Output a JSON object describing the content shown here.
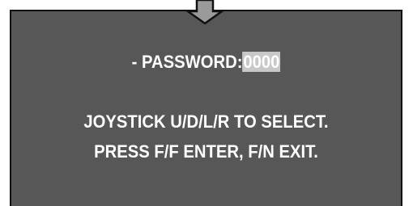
{
  "password": {
    "label": "- PASSWORD:",
    "value": "0000"
  },
  "instructions": {
    "line1": "JOYSTICK U/D/L/R TO SELECT.",
    "line2": "PRESS F/F ENTER, F/N EXIT."
  },
  "icons": {
    "arrow": "down-arrow-icon"
  },
  "colors": {
    "panel": "#575757",
    "text": "#ffffff",
    "highlight": "#c8c8c8"
  }
}
